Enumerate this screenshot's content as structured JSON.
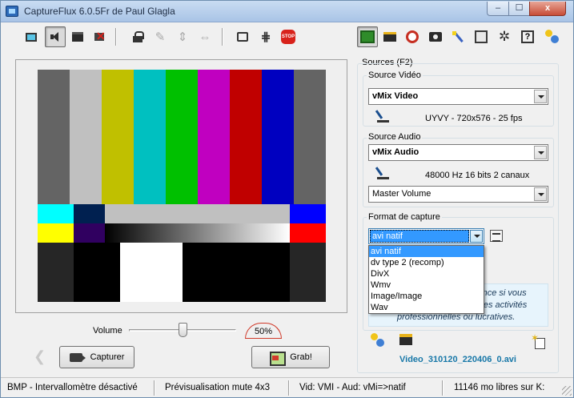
{
  "window": {
    "title": "CaptureFlux 6.0.5Fr de Paul Glagla",
    "controls": {
      "minimize": "–",
      "maximize": "☐",
      "close": "x"
    }
  },
  "toolbar": {
    "left_buttons": [
      {
        "icon": "monitor-icon",
        "pressed": false
      },
      {
        "icon": "speaker-icon",
        "pressed": true
      },
      {
        "icon": "computer-icon",
        "pressed": false
      },
      {
        "icon": "computer-disabled-icon",
        "pressed": false
      },
      {
        "icon": "lock-icon",
        "pressed": false
      },
      {
        "icon": "satellite-icon",
        "pressed": false,
        "disabled": true
      },
      {
        "icon": "resize-vertical-icon",
        "pressed": false,
        "disabled": true
      },
      {
        "icon": "resize-horizontal-icon",
        "pressed": false,
        "disabled": true
      },
      {
        "icon": "chat-icon",
        "pressed": false
      },
      {
        "icon": "grid-icon",
        "pressed": false
      },
      {
        "icon": "stop-icon",
        "pressed": false,
        "label": "STOP"
      }
    ],
    "right_buttons": [
      {
        "icon": "film-icon",
        "pressed": true
      },
      {
        "icon": "truck-icon",
        "pressed": false
      },
      {
        "icon": "alarm-clock-icon",
        "pressed": false
      },
      {
        "icon": "camera-icon",
        "pressed": false
      },
      {
        "icon": "magic-wand-icon",
        "pressed": false
      },
      {
        "icon": "preferences-icon",
        "pressed": false
      },
      {
        "icon": "gear-icon",
        "pressed": false
      },
      {
        "icon": "help-icon",
        "pressed": false,
        "label": "?"
      },
      {
        "icon": "keys-icon",
        "pressed": false
      }
    ]
  },
  "preview": {
    "test_pattern": {
      "top_colors": [
        "#646464",
        "#c0c0c0",
        "#c0c000",
        "#00c0c0",
        "#00c000",
        "#c000c0",
        "#c00000",
        "#0000c0",
        "#646464"
      ],
      "mid_row1": [
        "#00ffff",
        "#002050",
        "#c0c0c0",
        "#0000ff"
      ],
      "mid_row2": [
        "#ffff00",
        "#300060",
        "gradient",
        "#ff0000"
      ],
      "bottom": [
        "#262626",
        "#000000",
        "#ffffff",
        "#000000",
        "#262626"
      ]
    }
  },
  "volume": {
    "label": "Volume",
    "level_percent": 50,
    "readout": "50%"
  },
  "buttons": {
    "capture_label": "Capturer",
    "grab_label": "Grab!"
  },
  "sources": {
    "title": "Sources (F2)",
    "video": {
      "label": "Source Vidéo",
      "selected": "vMix Video",
      "info": "UYVY - 720x576 - 25 fps"
    },
    "audio": {
      "label": "Source Audio",
      "selected": "vMix Audio",
      "info": "48000 Hz 16 bits 2 canaux",
      "volume_selected": "Master Volume"
    },
    "format": {
      "label": "Format de capture",
      "selected": "avi natif",
      "options": [
        "avi natif",
        "dv type 2 (recomp)",
        "DivX",
        "Wmv",
        "Image/Image",
        "Wav"
      ]
    },
    "licence_text": [
      "cence si vous",
      "r des activités",
      "professionnelles ou lucratives."
    ]
  },
  "output": {
    "filename": "Video_310120_220406_0.avi"
  },
  "statusbar": {
    "cells": [
      "BMP - Intervallomètre désactivé",
      "Prévisualisation mute 4x3",
      "Vid: VMI - Aud: vMi=>natif",
      "11146 mo libres sur K:"
    ]
  }
}
